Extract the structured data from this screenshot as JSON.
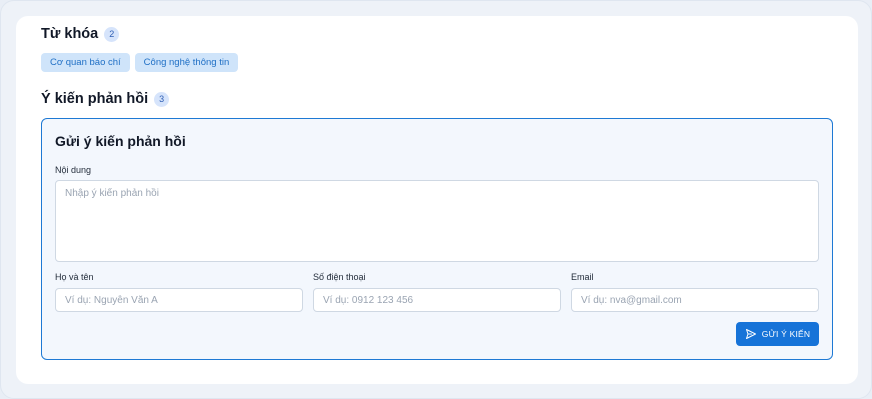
{
  "keywords": {
    "title": "Từ khóa",
    "count": "2",
    "tags": [
      "Cơ quan báo chí",
      "Công nghệ thông tin"
    ]
  },
  "feedback": {
    "title": "Ý kiến phản hồi",
    "count": "3"
  },
  "form": {
    "title": "Gửi ý kiến phản hồi",
    "content_label": "Nội dung",
    "content_placeholder": "Nhập ý kiến phản hồi",
    "name_label": "Họ và tên",
    "name_placeholder": "Ví dụ: Nguyễn Văn A",
    "phone_label": "Số điện thoại",
    "phone_placeholder": "Ví dụ: 0912 123 456",
    "email_label": "Email",
    "email_placeholder": "Ví dụ: nva@gmail.com",
    "submit_label": "GỬI Ý KIẾN",
    "submit_icon": "send-icon"
  },
  "colors": {
    "accent": "#1673d8",
    "form_border": "#1e79d4",
    "tag_bg": "#cfe4fa",
    "badge_bg": "#d6e4fb"
  }
}
